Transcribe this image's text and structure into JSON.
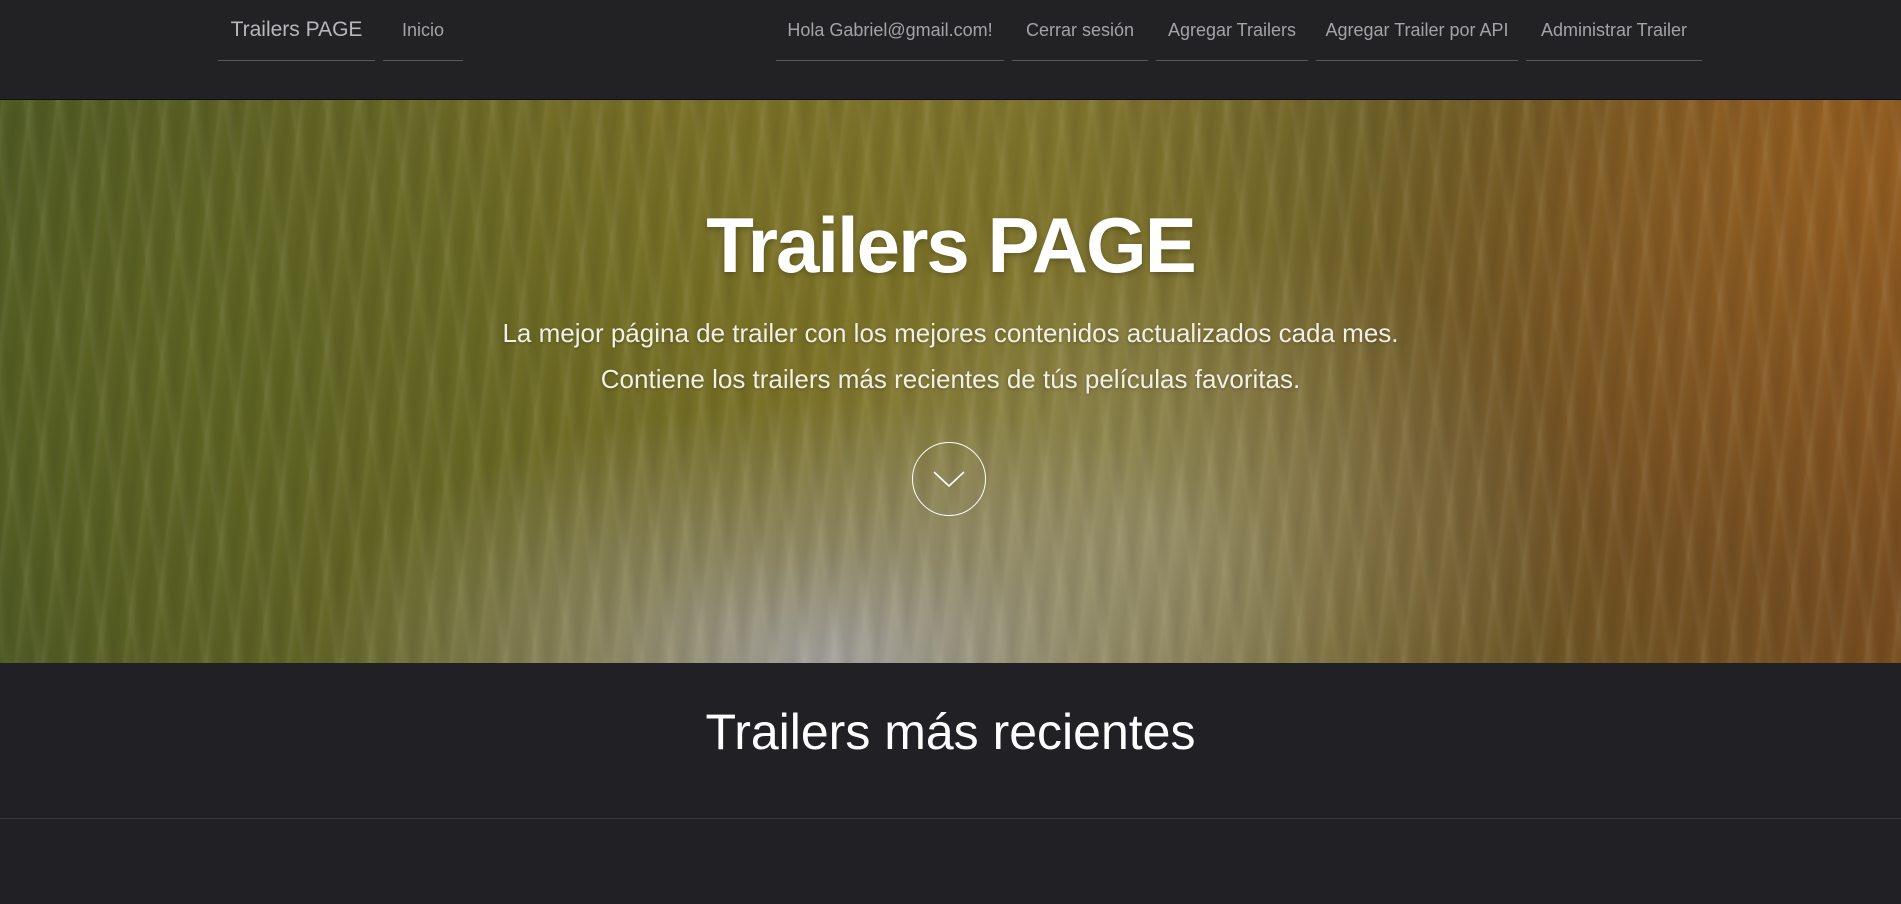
{
  "navbar": {
    "brand": "Trailers PAGE",
    "inicio": "Inicio",
    "greeting": "Hola Gabriel@gmail.com!",
    "logout": "Cerrar sesión",
    "add_trailers": "Agregar Trailers",
    "add_trailer_api": "Agregar Trailer por API",
    "manage_trailer": "Administrar Trailer"
  },
  "hero": {
    "title": "Trailers PAGE",
    "lead_line1": "La mejor página de trailer con los mejores contenidos actualizados cada mes.",
    "lead_line2": "Contiene los trailers más recientes de tús películas favoritas.",
    "scroll_icon": "chevron-down-icon"
  },
  "recent": {
    "title": "Trailers más recientes"
  },
  "colors": {
    "navbar_bg": "#222224",
    "page_bg": "#212025",
    "nav_text": "#a3a3a8",
    "hero_text": "#ffffff"
  }
}
